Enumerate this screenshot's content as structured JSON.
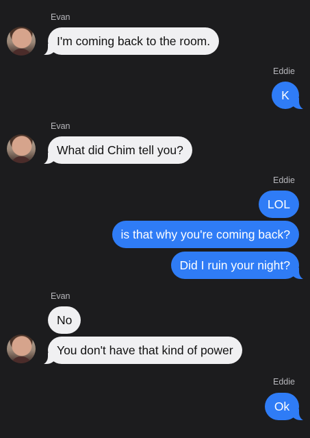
{
  "thread": {
    "incoming_sender": "Evan",
    "outgoing_sender": "Eddie",
    "messages": [
      {
        "from": "Evan",
        "text": "I'm coming back to the room."
      },
      {
        "from": "Eddie",
        "text": "K"
      },
      {
        "from": "Evan",
        "text": "What did Chim tell you?"
      },
      {
        "from": "Eddie",
        "text": "LOL"
      },
      {
        "from": "Eddie",
        "text": "is that why you're coming back?"
      },
      {
        "from": "Eddie",
        "text": "Did I ruin your night?"
      },
      {
        "from": "Evan",
        "text": "No"
      },
      {
        "from": "Evan",
        "text": "You don't have that kind of power"
      },
      {
        "from": "Eddie",
        "text": "Ok"
      }
    ]
  },
  "colors": {
    "background": "#1c1c1e",
    "incoming_bubble": "#f0f0f2",
    "outgoing_bubble": "#2f7cf6"
  },
  "icons": {
    "avatar": "contact-avatar-photo"
  }
}
